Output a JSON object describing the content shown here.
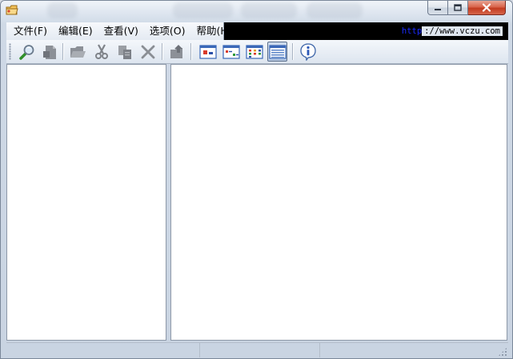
{
  "menubar": {
    "items": [
      {
        "label": "文件(F)"
      },
      {
        "label": "编辑(E)"
      },
      {
        "label": "查看(V)"
      },
      {
        "label": "选项(O)"
      },
      {
        "label": "帮助(H)"
      }
    ],
    "url_protocol": "http",
    "url_rest": "://www.vczu.com"
  },
  "toolbar": {
    "buttons": [
      {
        "icon": "search-icon",
        "enabled": true
      },
      {
        "icon": "properties-icon",
        "enabled": false
      },
      {
        "icon": "folder-open-icon",
        "enabled": false
      },
      {
        "icon": "cut-icon",
        "enabled": false
      },
      {
        "icon": "copy-icon",
        "enabled": false
      },
      {
        "icon": "delete-icon",
        "enabled": false
      },
      {
        "icon": "go-up-icon",
        "enabled": false
      },
      {
        "icon": "large-icons-view-icon",
        "enabled": true
      },
      {
        "icon": "small-icons-view-icon",
        "enabled": true
      },
      {
        "icon": "list-view-icon",
        "enabled": true
      },
      {
        "icon": "details-view-icon",
        "enabled": true,
        "pressed": true
      },
      {
        "icon": "about-info-icon",
        "enabled": true
      }
    ]
  },
  "statusbar": {
    "parts": [
      "",
      "",
      ""
    ]
  },
  "colors": {
    "menubar_background": "#000000",
    "url_protocol": "#1b2cff",
    "close_button": "#c23b20",
    "chrome": "#dce4ee"
  }
}
